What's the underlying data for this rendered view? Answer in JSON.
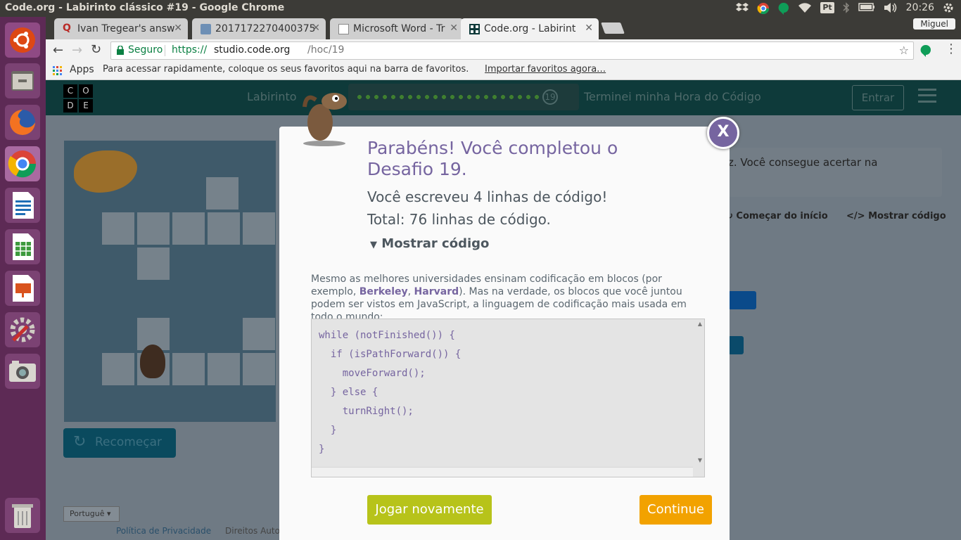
{
  "os": {
    "window_title": "Code.org - Labirinto clássico #19 - Google Chrome",
    "clock": "20:26",
    "keyboard_layout": "Pt",
    "user": "Miguel"
  },
  "tabs": [
    {
      "label": "Ivan Tregear's answ",
      "icon": "quora-icon"
    },
    {
      "label": "2017172270400375",
      "icon": "generic-icon"
    },
    {
      "label": "Microsoft Word - Tr",
      "icon": "document-icon"
    },
    {
      "label": "Code.org - Labirint",
      "icon": "codeorg-icon"
    }
  ],
  "toolbar": {
    "secure_label": "Seguro",
    "url_scheme": "https://",
    "url_host": "studio.code.org",
    "url_path": "/hoc/19"
  },
  "bookmarks": {
    "apps_label": "Apps",
    "hint": "Para acessar rapidamente, coloque os seus favoritos aqui na barra de favoritos.",
    "import_link": "Importar favoritos agora…"
  },
  "codeorg": {
    "logo_letters": [
      "C",
      "O",
      "D",
      "E"
    ],
    "puzzle_name": "Labirinto",
    "level_badge": "19",
    "hoc_link": "Terminei minha Hora do Código",
    "signin": "Entrar",
    "instruction_fragment": "z. Você consegue acertar na",
    "start_over": "Começar do início",
    "show_code": "Mostrar código",
    "reset": "Recomeçar",
    "language": "Portuguê",
    "privacy": "Política de Privacidade",
    "rights": "Direitos Auto"
  },
  "modal": {
    "close": "X",
    "heading": "Parabéns! Você completou o Desafio 19.",
    "lines_written": "Você escreveu 4 linhas de código!",
    "lines_total": "Total: 76 linhas de código.",
    "show_code_toggle": "Mostrar código",
    "explain_1": "Mesmo as melhores universidades ensinam codificação em blocos (por exemplo, ",
    "berkeley": "Berkeley",
    "comma": ", ",
    "harvard": "Harvard",
    "explain_2": "). Mas na verdade, os blocos que você juntou podem ser vistos em JavaScript, a linguagem de codificação mais usada em todo o mundo:",
    "code_lines": [
      "while (notFinished()) {",
      "  if (isPathForward()) {",
      "    moveForward();",
      "  } else {",
      "    turnRight();",
      "  }",
      "}"
    ],
    "replay": "Jogar novamente",
    "continue": "Continue"
  },
  "colors": {
    "accent_purple": "#7665a0",
    "replay_green": "#b7c31a",
    "continue_orange": "#f2a200",
    "launcher": "#5d2a55",
    "codeorg_header": "#0e3a3a"
  }
}
